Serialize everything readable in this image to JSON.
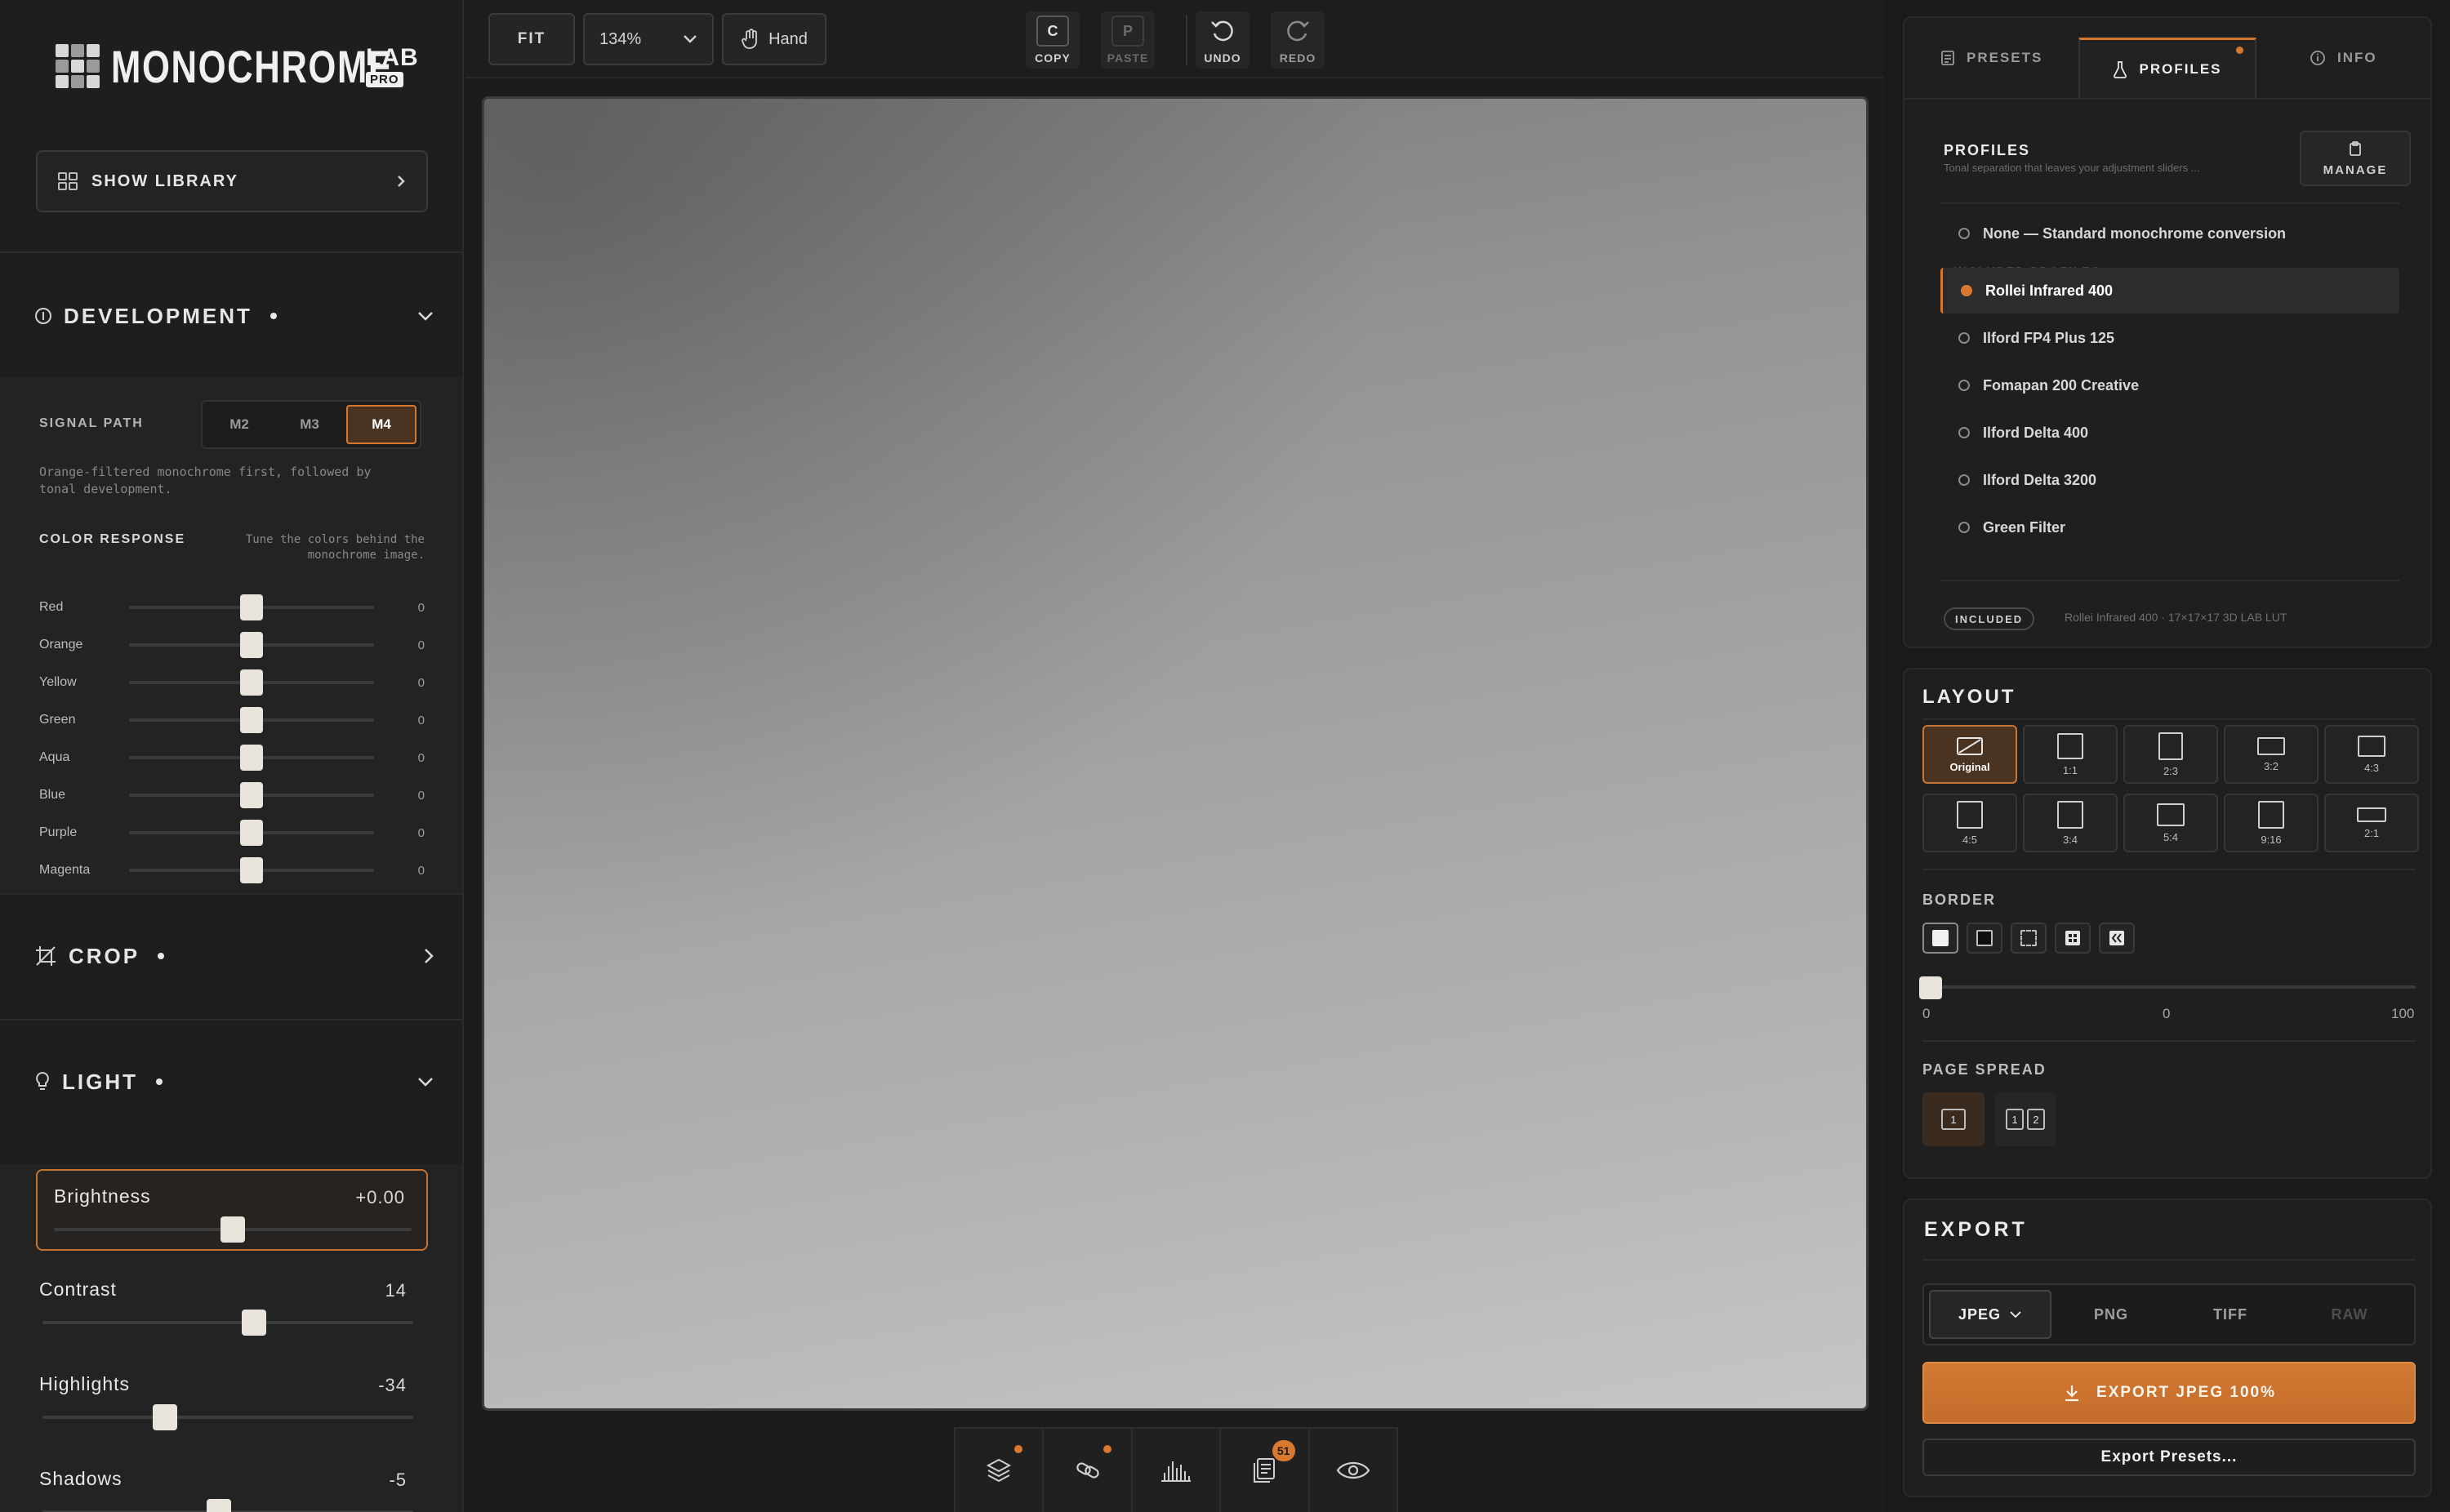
{
  "app": {
    "logo_main": "MONOCHROME",
    "logo_lab": "LAB",
    "logo_pro": "PRO"
  },
  "library": {
    "label": "SHOW LIBRARY"
  },
  "development": {
    "title": "DEVELOPMENT",
    "signal_path_label": "SIGNAL PATH",
    "signal_paths": [
      "M2",
      "M3",
      "M4"
    ],
    "signal_path_selected": "M4",
    "description": "Orange-filtered monochrome first, followed by tonal development.",
    "color_response_label": "COLOR RESPONSE",
    "color_response_hint": "Tune the colors behind the monochrome image.",
    "colors": [
      {
        "name": "Red",
        "value": "0"
      },
      {
        "name": "Orange",
        "value": "0"
      },
      {
        "name": "Yellow",
        "value": "0"
      },
      {
        "name": "Green",
        "value": "0"
      },
      {
        "name": "Aqua",
        "value": "0"
      },
      {
        "name": "Blue",
        "value": "0"
      },
      {
        "name": "Purple",
        "value": "0"
      },
      {
        "name": "Magenta",
        "value": "0"
      }
    ]
  },
  "crop": {
    "title": "CROP"
  },
  "light": {
    "title": "LIGHT",
    "sliders": [
      {
        "name": "Brightness",
        "value": "+0.00",
        "position": 0.5
      },
      {
        "name": "Contrast",
        "value": "14",
        "position": 0.57
      },
      {
        "name": "Highlights",
        "value": "-34",
        "position": 0.33
      },
      {
        "name": "Shadows",
        "value": "-5",
        "position": 0.475
      }
    ]
  },
  "toolbar": {
    "fit": "FIT",
    "zoom": "134%",
    "hand": "Hand",
    "copy_key": "C",
    "copy": "COPY",
    "paste_key": "P",
    "paste": "PASTE",
    "undo": "UNDO",
    "redo": "REDO"
  },
  "dock": {
    "history_badge": "51"
  },
  "right_tabs": [
    "PRESETS",
    "PROFILES",
    "INFO"
  ],
  "profiles": {
    "title": "PROFILES",
    "subtitle": "Tonal separation that leaves your adjustment sliders ...",
    "manage": "MANAGE",
    "none_option": "None — Standard monochrome conversion",
    "category": "INCLUDED PROFILES",
    "items": [
      "Rollei Infrared 400",
      "Ilford FP4 Plus 125",
      "Fomapan 200 Creative",
      "Ilford Delta 400",
      "Ilford Delta 3200",
      "Green Filter"
    ],
    "selected": "Rollei Infrared 400",
    "included_badge": "INCLUDED",
    "included_info": "Rollei Infrared 400 · 17×17×17 3D LAB LUT"
  },
  "layout": {
    "title": "LAYOUT",
    "ratios": [
      "Original",
      "1:1",
      "2:3",
      "3:2",
      "4:3",
      "4:5",
      "3:4",
      "5:4",
      "9:16",
      "2:1"
    ],
    "selected_ratio": "Original",
    "border_title": "BORDER",
    "border_min": "0",
    "border_value": "0",
    "border_max": "100",
    "page_spread_title": "PAGE SPREAD",
    "spread_single": "1",
    "spread_double_a": "1",
    "spread_double_b": "2"
  },
  "export": {
    "title": "EXPORT",
    "formats": [
      "JPEG",
      "PNG",
      "TIFF",
      "RAW"
    ],
    "selected_format": "JPEG",
    "button": "EXPORT JPEG 100%",
    "presets": "Export Presets..."
  },
  "colors": {
    "accent": "#d4782f",
    "panel": "#1e1e1e",
    "background": "#1c1c1c"
  }
}
